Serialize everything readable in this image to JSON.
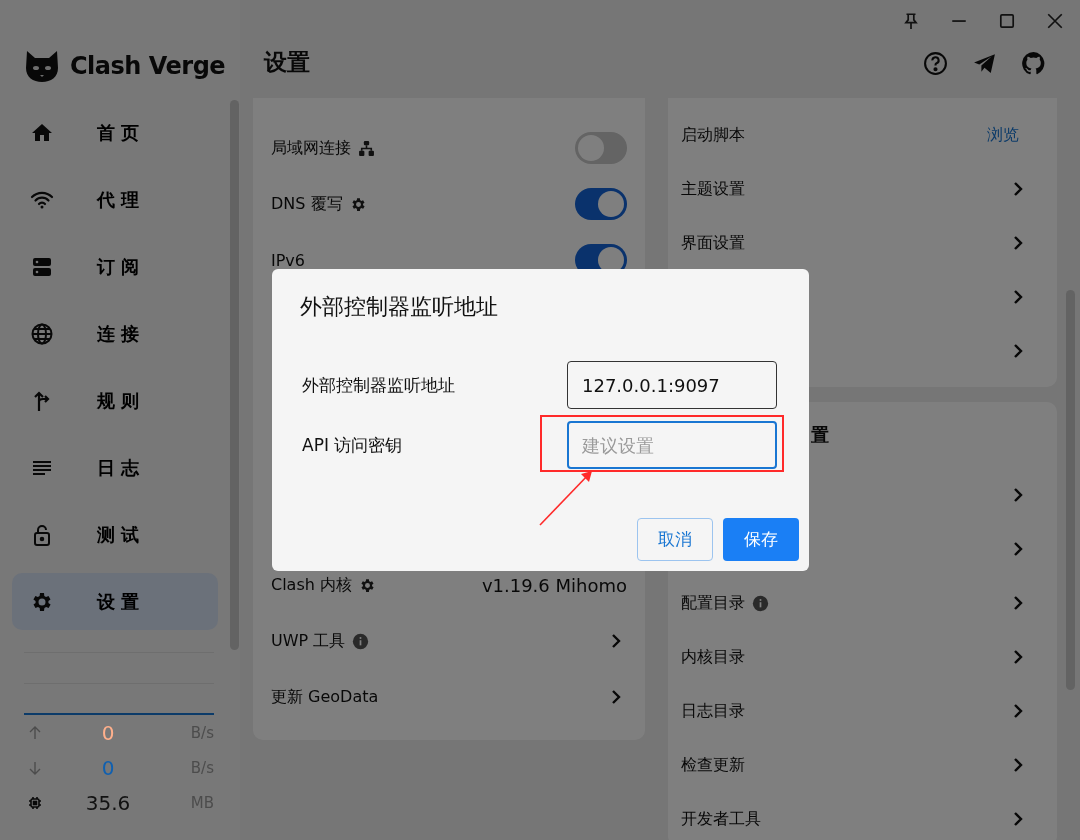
{
  "app": {
    "name": "Clash Verge"
  },
  "sidebar": {
    "items": [
      {
        "label": "首页",
        "selected": false
      },
      {
        "label": "代理",
        "selected": false
      },
      {
        "label": "订阅",
        "selected": false
      },
      {
        "label": "连接",
        "selected": false
      },
      {
        "label": "规则",
        "selected": false
      },
      {
        "label": "日志",
        "selected": false
      },
      {
        "label": "测试",
        "selected": false
      },
      {
        "label": "设置",
        "selected": true
      }
    ]
  },
  "traffic": [
    {
      "kind": "upload",
      "value": "0",
      "unit": "B/s",
      "color": "#ffb08c"
    },
    {
      "kind": "download",
      "value": "0",
      "unit": "B/s",
      "color": "#1060b0"
    },
    {
      "kind": "memory",
      "value": "35.6",
      "unit": "MB",
      "color": "#111111"
    }
  ],
  "page_title": "设置",
  "left_panel": {
    "rows": [
      {
        "label": "局域网连接",
        "kind": "toggle",
        "on": false
      },
      {
        "label": "DNS 覆写",
        "kind": "toggle",
        "on": true
      },
      {
        "label": "IPv6",
        "kind": "toggle",
        "on": true
      },
      {
        "label": "Clash 内核",
        "kind": "value",
        "value": "v1.19.6 Mihomo"
      },
      {
        "label": "UWP 工具",
        "kind": "chevron"
      },
      {
        "label": "更新 GeoData",
        "kind": "chevron"
      }
    ]
  },
  "right_panels": [
    {
      "rows": [
        {
          "label": "启动脚本",
          "kind": "link",
          "action": "浏览"
        },
        {
          "label": "主题设置",
          "kind": "chevron"
        },
        {
          "label": "界面设置",
          "kind": "chevron"
        },
        {
          "kind": "chevron"
        },
        {
          "kind": "chevron"
        }
      ]
    },
    {
      "heading": "置",
      "rows": [
        {
          "kind": "chevron"
        },
        {
          "kind": "chevron"
        },
        {
          "label": "配置目录",
          "kind": "chevron"
        },
        {
          "label": "内核目录",
          "kind": "chevron"
        },
        {
          "label": "日志目录",
          "kind": "chevron"
        },
        {
          "label": "检查更新",
          "kind": "chevron"
        },
        {
          "label": "开发者工具",
          "kind": "chevron"
        }
      ]
    }
  ],
  "dialog": {
    "title": "外部控制器监听地址",
    "fields": [
      {
        "label": "外部控制器监听地址",
        "value": "127.0.0.1:9097",
        "focused": false
      },
      {
        "label": "API 访问密钥",
        "placeholder": "建议设置",
        "focused": true
      }
    ],
    "buttons": [
      {
        "label": "取消",
        "kind": "outlined"
      },
      {
        "label": "保存",
        "kind": "primary"
      }
    ]
  }
}
